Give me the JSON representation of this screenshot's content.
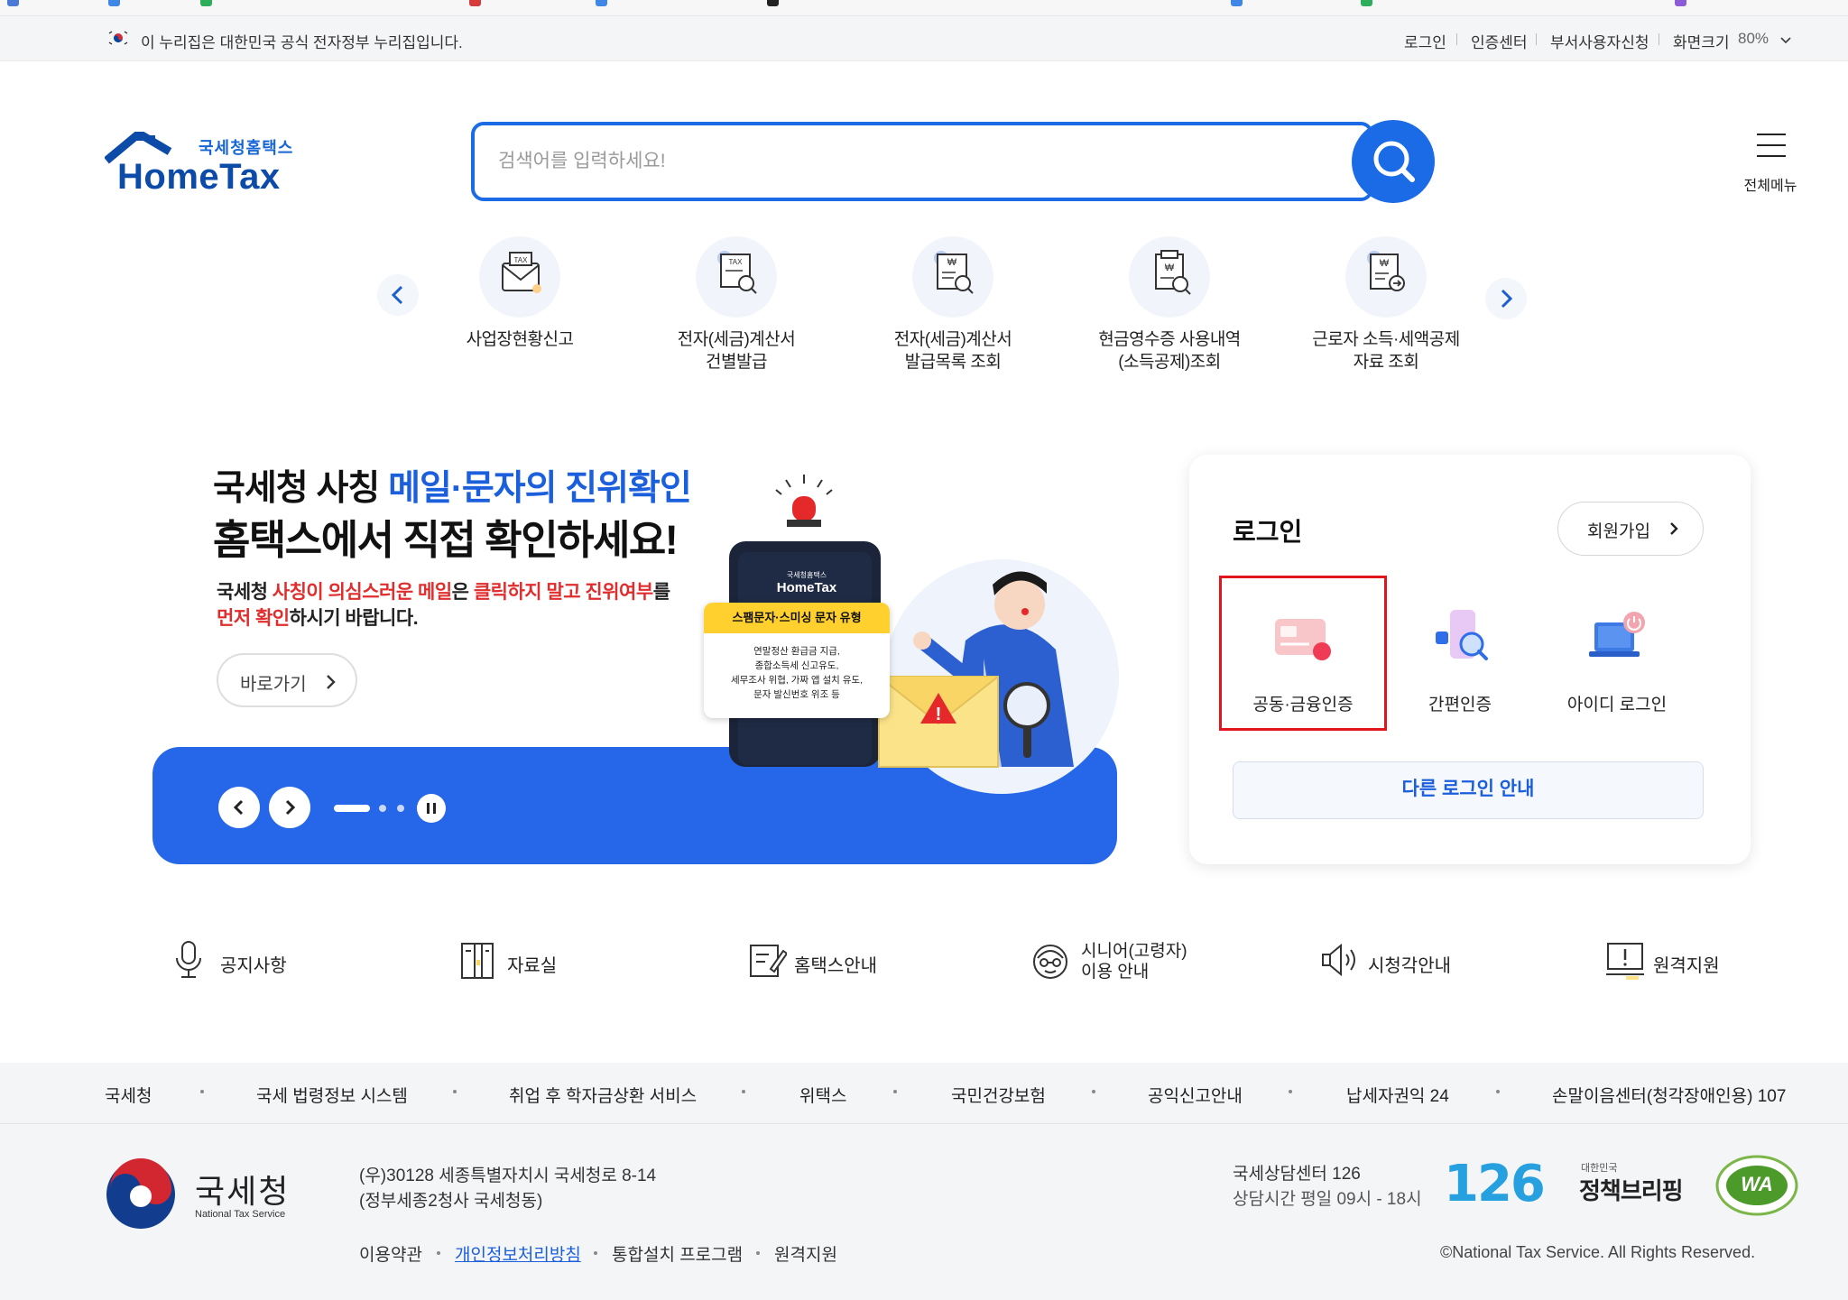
{
  "gov_banner": {
    "text": "이 누리집은 대한민국 공식 전자정부 누리집입니다.",
    "links": [
      "로그인",
      "인증센터",
      "부서사용자신청"
    ],
    "zoom_label": "화면크기",
    "zoom_value": "80%"
  },
  "header": {
    "logo_kr": "국세청홈택스",
    "logo_en": "HomeTax",
    "search_placeholder": "검색어를 입력하세요!",
    "menu_label": "전체메뉴"
  },
  "quick_menu": [
    {
      "line1": "사업장현황신고",
      "line2": "",
      "icon": "mail-tax-icon"
    },
    {
      "line1": "전자(세금)계산서",
      "line2": "건별발급",
      "icon": "tax-document-search-icon"
    },
    {
      "line1": "전자(세금)계산서",
      "line2": "발급목록 조회",
      "icon": "won-list-search-icon"
    },
    {
      "line1": "현금영수증 사용내역",
      "line2": "(소득공제)조회",
      "icon": "receipt-search-icon"
    },
    {
      "line1": "근로자 소득·세액공제",
      "line2": "자료 조회",
      "icon": "won-document-icon"
    }
  ],
  "banner": {
    "title_part1": "국세청 사칭 ",
    "title_highlight": "메일·문자의 진위확인",
    "title_line2": "홈택스에서 직접 확인하세요!",
    "desc": {
      "p1": "국세청 ",
      "p2": "사칭이 의심스러운 메일",
      "p3": "은 ",
      "p4": "클릭하지 말고 진위여부",
      "p5": "를",
      "p6": "먼저 확인",
      "p7": "하시기 바랍니다."
    },
    "link_label": "바로가기",
    "phone_brand_kr": "국세청홈택스",
    "phone_brand_en": "HomeTax",
    "warning_tag": "스팸문자·스미싱 문자 유형",
    "warning_lines": [
      "연말정산 환급금 지급,",
      "종합소득세 신고유도,",
      "세무조사 위협, 가짜 앱 설치 유도,",
      "문자 발신번호 위조 등"
    ]
  },
  "login": {
    "title": "로그인",
    "signup": "회원가입",
    "options": [
      {
        "label": "공동·금융인증",
        "icon": "certificate-card-icon"
      },
      {
        "label": "간편인증",
        "icon": "phone-search-icon"
      },
      {
        "label": "아이디 로그인",
        "icon": "laptop-power-icon"
      }
    ],
    "other": "다른 로그인 안내"
  },
  "shortcuts": [
    {
      "label": "공지사항",
      "icon": "microphone-icon"
    },
    {
      "label": "자료실",
      "icon": "archive-icon"
    },
    {
      "label": "홈택스안내",
      "icon": "edit-board-icon"
    },
    {
      "line1": "시니어(고령자)",
      "line2": "이용 안내",
      "icon": "senior-icon"
    },
    {
      "label": "시청각안내",
      "icon": "speaker-icon"
    },
    {
      "label": "원격지원",
      "icon": "monitor-alert-icon"
    }
  ],
  "footer": {
    "links": [
      "국세청",
      "국세 법령정보 시스템",
      "취업 후 학자금상환 서비스",
      "위택스",
      "국민건강보험",
      "공익신고안내",
      "납세자권익 24",
      "손말이음센터(청각장애인용) 107"
    ],
    "org_kr": "국세청",
    "org_en": "National Tax Service",
    "address1": "(우)30128 세종특별자치시 국세청로 8-14",
    "address2": "(정부세종2청사 국세청동)",
    "bottom_links": [
      "이용약관",
      "개인정보처리방침",
      "통합설치 프로그램",
      "원격지원"
    ],
    "center_name": "국세상담센터 126",
    "center_hours": "상담시간 평일 09시 - 18시",
    "badge_126": "126",
    "policy_small": "대한민국",
    "policy_big": "정책브리핑",
    "wa_text": "WA",
    "copyright": "©National Tax Service. All Rights Reserved."
  }
}
